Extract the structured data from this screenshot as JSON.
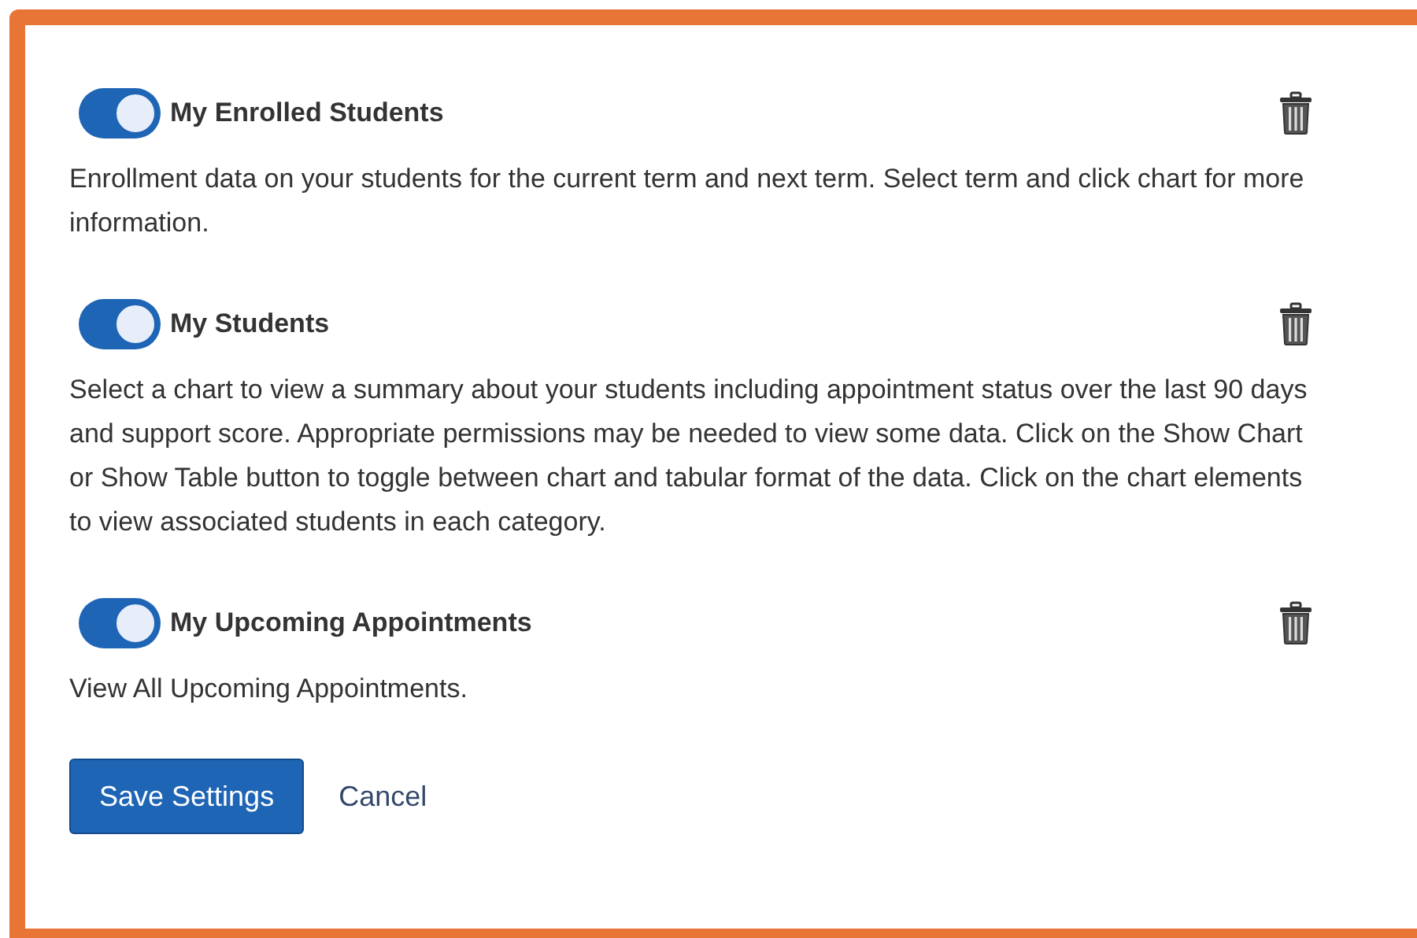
{
  "widgets": [
    {
      "title": "My Enrolled Students",
      "on": true,
      "description": "Enrollment data on your students for the current term and next term. Select term and click chart for more information."
    },
    {
      "title": "My Students",
      "on": true,
      "description": "Select a chart to view a summary about your students including appointment status over the last 90 days and support score. Appropriate permissions may be needed to view some data. Click on the Show Chart or Show Table button to toggle between chart and tabular format of the data. Click on the chart elements to view associated students in each category."
    },
    {
      "title": "My Upcoming Appointments",
      "on": true,
      "description": "View All Upcoming Appointments."
    }
  ],
  "buttons": {
    "save": "Save Settings",
    "cancel": "Cancel"
  }
}
